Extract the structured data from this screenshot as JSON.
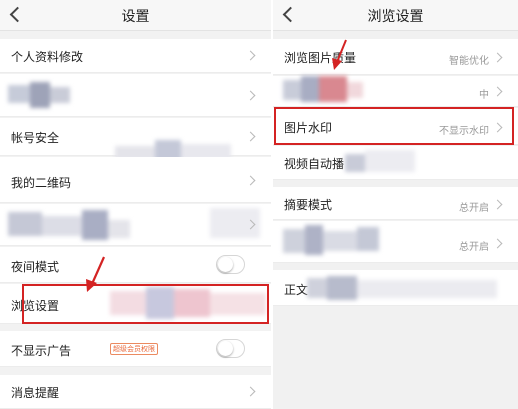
{
  "left": {
    "title": "设置",
    "items": [
      {
        "label": "个人资料修改"
      },
      {
        "label": "帐号安全"
      },
      {
        "label": "我的二维码"
      },
      {
        "label": "夜间模式"
      },
      {
        "label": "浏览设置"
      },
      {
        "label": "不显示广告",
        "badge": "超级会员权限"
      },
      {
        "label": "消息提醒"
      }
    ]
  },
  "right": {
    "title": "浏览设置",
    "items": [
      {
        "label": "浏览图片质量",
        "value": "智能优化"
      },
      {
        "value": "中"
      },
      {
        "label": "图片水印",
        "value": "不显示水印"
      },
      {
        "label": "视频自动播"
      },
      {
        "label": "摘要模式",
        "value": "总开启"
      },
      {
        "value": "总开启"
      },
      {
        "label": "正文"
      }
    ]
  },
  "colors": {
    "highlight": "#d42323",
    "accent": "#e96a3d"
  }
}
